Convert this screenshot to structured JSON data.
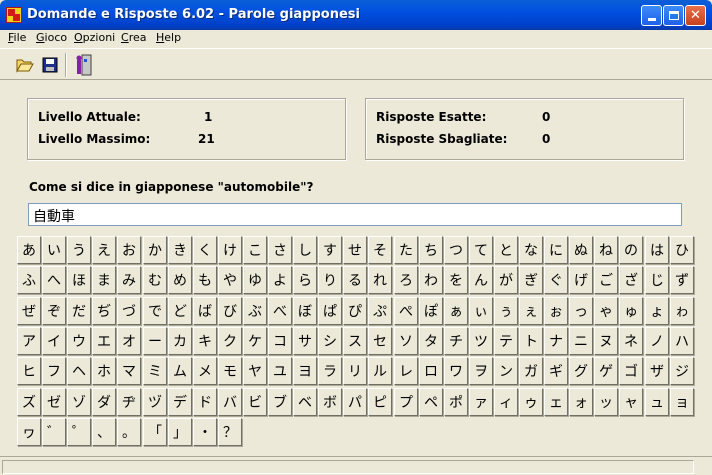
{
  "window": {
    "title": "Domande e Risposte 6.02 - Parole giapponesi"
  },
  "menu": [
    {
      "label": "File",
      "accel": "F",
      "rest": "ile"
    },
    {
      "label": "Gioco",
      "accel": "G",
      "rest": "ioco"
    },
    {
      "label": "Opzioni",
      "accel": "O",
      "rest": "pzioni"
    },
    {
      "label": "Crea",
      "accel": "C",
      "rest": "rea"
    },
    {
      "label": "Help",
      "accel": "H",
      "rest": "elp"
    }
  ],
  "toolbar": {
    "icons": [
      "open-folder-icon",
      "save-disk-icon",
      "exit-door-icon"
    ]
  },
  "stats_left": {
    "current_level_label": "Livello Attuale:",
    "current_level_value": "1",
    "max_level_label": "Livello Massimo:",
    "max_level_value": "21"
  },
  "stats_right": {
    "correct_label": "Risposte Esatte:",
    "correct_value": "0",
    "wrong_label": "Risposte Sbagliate:",
    "wrong_value": "0"
  },
  "question": "Come si dice in giapponese \"automobile\"?",
  "answer_value": "自動車",
  "keyboard": {
    "rows": [
      [
        "あ",
        "い",
        "う",
        "え",
        "お",
        "か",
        "き",
        "く",
        "け",
        "こ",
        "さ",
        "し",
        "す",
        "せ",
        "そ",
        "た",
        "ち",
        "つ",
        "て",
        "と",
        "な",
        "に",
        "ぬ",
        "ね",
        "の",
        "は",
        "ひ"
      ],
      [
        "ふ",
        "へ",
        "ほ",
        "ま",
        "み",
        "む",
        "め",
        "も",
        "や",
        "ゆ",
        "よ",
        "ら",
        "り",
        "る",
        "れ",
        "ろ",
        "わ",
        "を",
        "ん",
        "が",
        "ぎ",
        "ぐ",
        "げ",
        "ご",
        "ざ",
        "じ",
        "ず"
      ],
      [
        "ぜ",
        "ぞ",
        "だ",
        "ぢ",
        "づ",
        "で",
        "ど",
        "ば",
        "び",
        "ぶ",
        "べ",
        "ぼ",
        "ぱ",
        "ぴ",
        "ぷ",
        "ぺ",
        "ぽ",
        "ぁ",
        "ぃ",
        "ぅ",
        "ぇ",
        "ぉ",
        "っ",
        "ゃ",
        "ゅ",
        "ょ",
        "ゎ"
      ],
      [
        "ア",
        "イ",
        "ウ",
        "エ",
        "オ",
        "ー",
        "カ",
        "キ",
        "ク",
        "ケ",
        "コ",
        "サ",
        "シ",
        "ス",
        "セ",
        "ソ",
        "タ",
        "チ",
        "ツ",
        "テ",
        "ト",
        "ナ",
        "ニ",
        "ヌ",
        "ネ",
        "ノ",
        "ハ"
      ],
      [
        "ヒ",
        "フ",
        "ヘ",
        "ホ",
        "マ",
        "ミ",
        "ム",
        "メ",
        "モ",
        "ヤ",
        "ユ",
        "ヨ",
        "ラ",
        "リ",
        "ル",
        "レ",
        "ロ",
        "ワ",
        "ヲ",
        "ン",
        "ガ",
        "ギ",
        "グ",
        "ゲ",
        "ゴ",
        "ザ",
        "ジ"
      ],
      [
        "ズ",
        "ゼ",
        "ゾ",
        "ダ",
        "ヂ",
        "ヅ",
        "デ",
        "ド",
        "バ",
        "ビ",
        "ブ",
        "ベ",
        "ボ",
        "パ",
        "ピ",
        "プ",
        "ペ",
        "ポ",
        "ァ",
        "ィ",
        "ゥ",
        "ェ",
        "ォ",
        "ッ",
        "ャ",
        "ュ",
        "ョ"
      ],
      [
        "ヮ",
        "゛",
        "゜",
        "、",
        "。",
        "「",
        "」",
        "・",
        "？"
      ]
    ]
  }
}
